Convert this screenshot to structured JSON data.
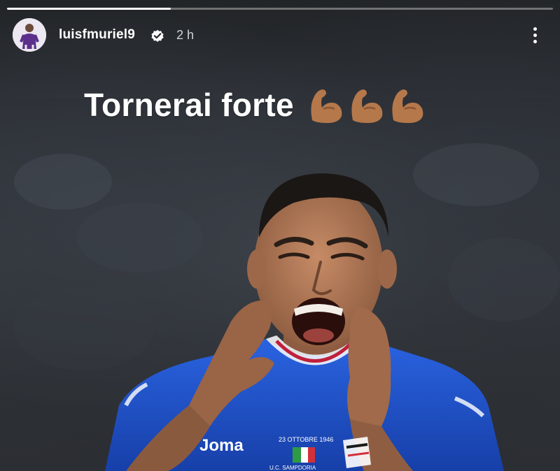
{
  "story": {
    "progress": 0.3,
    "username": "luisfmuriel9",
    "verified": true,
    "time": "2 h",
    "caption": "Tornerai forte",
    "caption_emoji_count": 3,
    "caption_emoji_name": "flexed-biceps-icon",
    "jersey_brand": "Joma",
    "patch_text": "23 OTTOBRE 1946",
    "patch_subtext": "U.C. SAMPDORIA"
  },
  "colors": {
    "jersey": "#1d52c9",
    "skin": "#b07a5a",
    "emoji": "#b5784b",
    "background": "#2a2d32"
  }
}
